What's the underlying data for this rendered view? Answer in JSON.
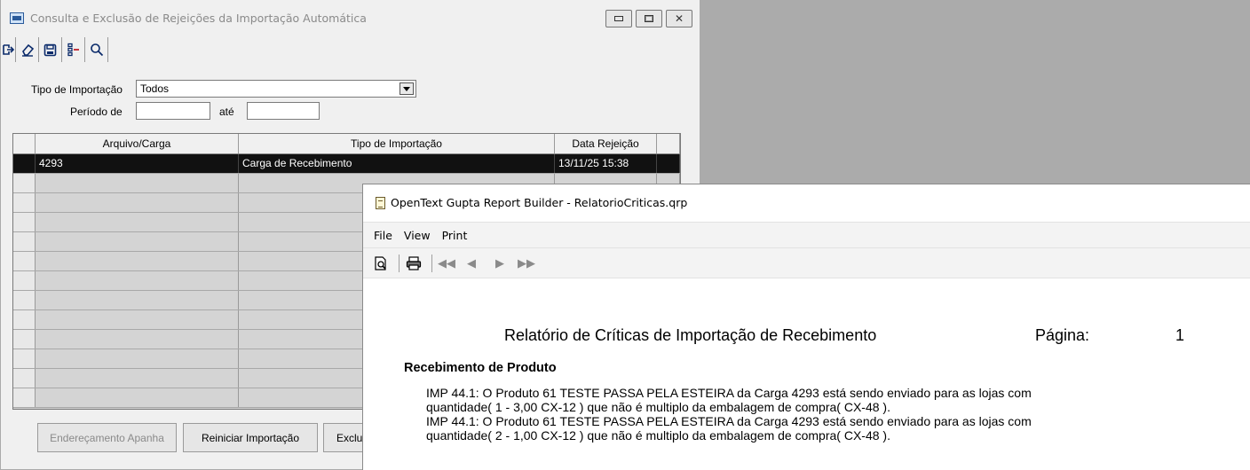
{
  "window1": {
    "title": "Consulta e Exclusão de Rejeições da Importação Automática",
    "toolbar_icons": [
      "exit-icon",
      "eraser-icon",
      "save-icon",
      "list-icon",
      "search-icon"
    ],
    "form": {
      "tipo_label": "Tipo de Importação",
      "tipo_value": "Todos",
      "periodo_label": "Período de",
      "periodo_from": "",
      "ate_label": "até",
      "periodo_to": ""
    },
    "grid": {
      "columns": [
        "Arquivo/Carga",
        "Tipo de Importação",
        "Data Rejeição"
      ],
      "rows": [
        {
          "arquivo": "4293",
          "tipo": "Carga de Recebimento",
          "data": "13/11/25  15:38"
        }
      ]
    },
    "buttons": {
      "enderecamento": "Endereçamento Apanha",
      "reiniciar": "Reiniciar Importação",
      "excluir": "Exclu"
    }
  },
  "window2": {
    "title": "OpenText Gupta Report Builder - RelatorioCriticas.qrp",
    "menu": [
      "File",
      "View",
      "Print"
    ],
    "report": {
      "title": "Relatório de Críticas de Importação de Recebimento",
      "page_label": "Página:",
      "page_number": "1",
      "section": "Recebimento de Produto",
      "lines": [
        "IMP 44.1: O Produto 61 TESTE PASSA PELA ESTEIRA da Carga 4293 está sendo enviado para as lojas com",
        "quantidade( 1 - 3,00 CX-12 ) que não é multiplo da embalagem de compra( CX-48 ).",
        "IMP 44.1: O Produto 61 TESTE PASSA PELA ESTEIRA da Carga 4293 está sendo enviado para as lojas com",
        "quantidade( 2 - 1,00 CX-12 ) que não é multiplo da embalagem de compra( CX-48 )."
      ]
    }
  }
}
